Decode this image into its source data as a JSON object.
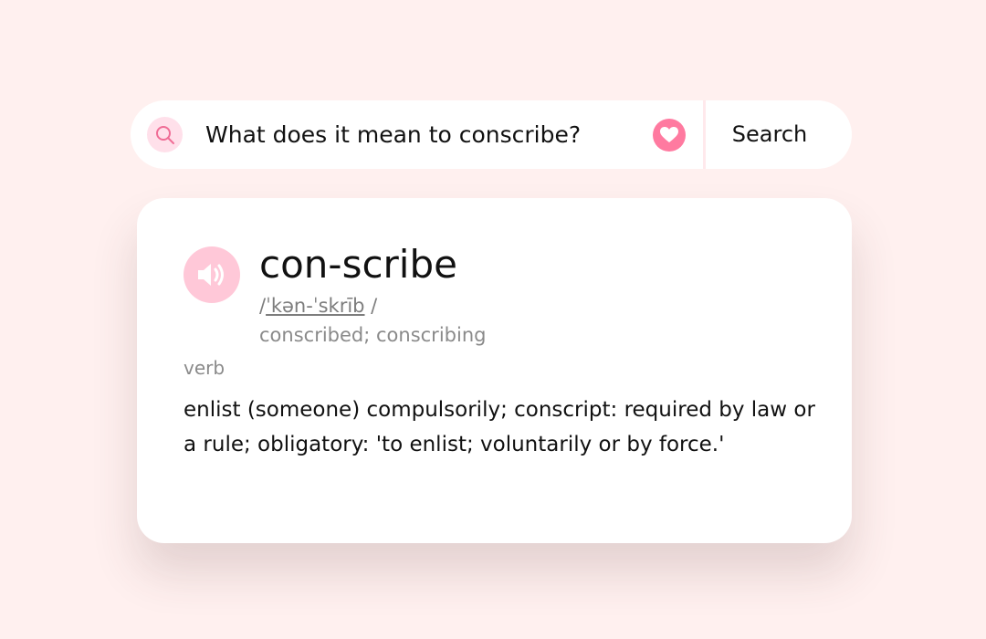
{
  "search": {
    "query": "What does it mean to conscribe?",
    "button_label": "Search",
    "search_icon": "search-icon",
    "favorite_icon": "heart-icon"
  },
  "entry": {
    "headword": "con-scribe",
    "pronunciation_open": "/",
    "pronunciation": "ˈkən-ˈskrīb",
    "pronunciation_close": " /",
    "inflections": "conscribed; conscribing",
    "part_of_speech": "verb",
    "definition": "enlist (someone) compulsorily; conscript: required by law or a rule; obligatory: 'to enlist; voluntarily or by force.'",
    "audio_icon": "speaker-icon"
  },
  "colors": {
    "background": "#fff0ef",
    "accent": "#ff7aa0",
    "accent_light": "#ffc8d8",
    "search_icon_bg": "#ffe0ea"
  }
}
